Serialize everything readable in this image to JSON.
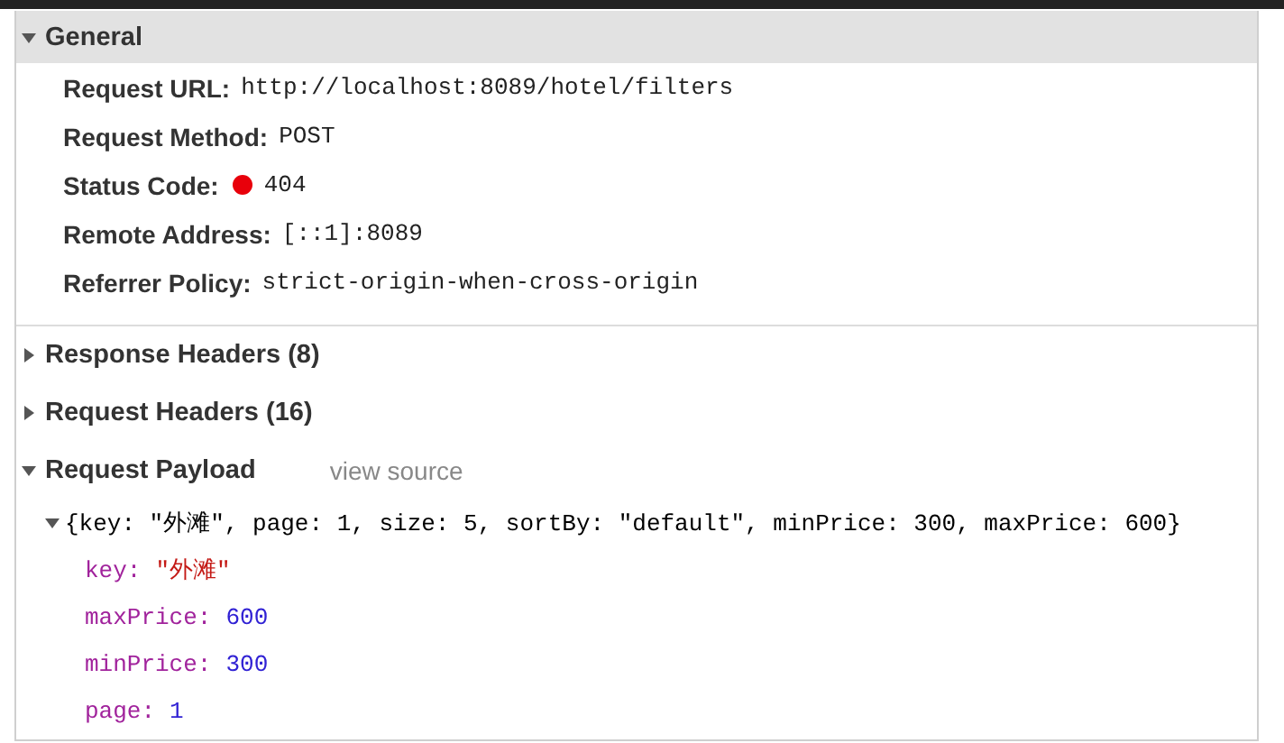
{
  "general": {
    "title": "General",
    "expanded": true,
    "rows": [
      {
        "label": "Request URL:",
        "value": "http://localhost:8089/hotel/filters"
      },
      {
        "label": "Request Method:",
        "value": "POST"
      },
      {
        "label": "Status Code:",
        "value": "404",
        "color": "#e8000b"
      },
      {
        "label": "Remote Address:",
        "value": "[::1]:8089"
      },
      {
        "label": "Referrer Policy:",
        "value": "strict-origin-when-cross-origin"
      }
    ]
  },
  "sections": [
    {
      "title": "Response Headers (8)",
      "expanded": false
    },
    {
      "title": "Request Headers (16)",
      "expanded": false
    },
    {
      "title": "Request Payload",
      "expanded": true,
      "link": "view source",
      "payload": {
        "summary": "{key: \"外滩\", page: 1, size: 5, sortBy: \"default\", minPrice: 300, maxPrice: 600}",
        "expanded": true,
        "properties": [
          {
            "key": "key:",
            "value": "\"外滩\"",
            "kind": "string"
          },
          {
            "key": "maxPrice:",
            "value": "600",
            "kind": "number"
          },
          {
            "key": "minPrice:",
            "value": "300",
            "kind": "number"
          },
          {
            "key": "page:",
            "value": "1",
            "kind": "number"
          }
        ]
      }
    }
  ]
}
